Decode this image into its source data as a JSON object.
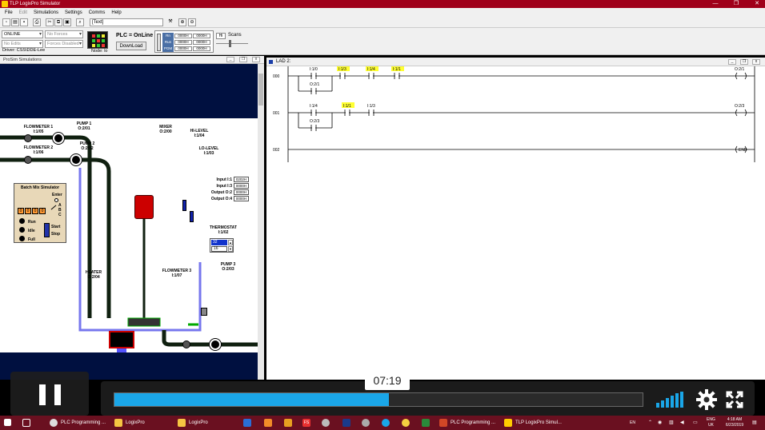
{
  "window": {
    "title": "TLP LogixPro Simulator"
  },
  "menu": [
    "File",
    "Edit",
    "Simulations",
    "Settings",
    "Comms",
    "Help"
  ],
  "toolbar": {
    "text_select": "[Text]"
  },
  "plc_panel": {
    "mode": "ONLINE",
    "forces": "No Forces",
    "edits": "No Edits",
    "forces_state": "Forces Disabled",
    "driver": "Driver: CSS\\DDE-Lee",
    "node": "Node: lo",
    "status": "PLC = OnLine",
    "download": "DownLoad",
    "rpm_labels": [
      "Rn",
      "Run",
      "PGM"
    ],
    "rpm_values": [
      [
        "0000H",
        "0000H"
      ],
      [
        "0000H",
        "0000H"
      ],
      [
        "0000H",
        "0000H"
      ]
    ],
    "scan_value": "Hi",
    "scan_label": "Scans"
  },
  "sim": {
    "title": "ProSim Simulations",
    "flowmeter1": "FLOWMETER 1\nI:1/05",
    "flowmeter2": "FLOWMETER 2\nI:1/06",
    "pump1": "PUMP 1\nO:2/01",
    "pump2": "PUMP 2\nO:2/02",
    "mixer": "MIXER\nO:2/00",
    "hilevel": "HI-LEVEL\nI:1/04",
    "lolevel": "LO-LEVEL\nI:1/03",
    "input1": "Input I:1",
    "input1_val": "0202H",
    "input3": "Input I:3",
    "input3_val": "0000H",
    "output2": "Output O:2",
    "output2_val": "0000H",
    "output4": "Output O:4",
    "output4_val": "0000H",
    "thermostat": "THERMOSTAT\nI:1/02",
    "thermo_set": "32",
    "thermo_act": "16",
    "pump3": "PUMP 3\nO:2/03",
    "flowmeter3": "FLOWMETER 3\nI:1/07",
    "heater": "HEATER\nO:2/04",
    "batch_title": "Batch Mix Simulator",
    "enter": "Enter",
    "abc": [
      "A",
      "B",
      "C"
    ],
    "digits": [
      "0",
      "0",
      "0",
      "0"
    ],
    "run": "Run",
    "idle": "Idle",
    "full": "Full",
    "start": "Start",
    "stop": "Stop"
  },
  "lad": {
    "title": "LAD 2:",
    "rungs": [
      {
        "num": "000",
        "contacts": [
          "I:1/0",
          "I:1/3",
          "I:1/4",
          "I:1/1"
        ],
        "highlight": [
          false,
          true,
          true,
          true
        ],
        "branch": "O:2/1",
        "coil": "O:2/1"
      },
      {
        "num": "001",
        "contacts": [
          "I:1/4",
          "I:1/1",
          "I:1/3"
        ],
        "highlight": [
          false,
          true,
          false
        ],
        "branch": "O:2/3",
        "coil": "O:2/3"
      },
      {
        "num": "002",
        "end": "END"
      }
    ]
  },
  "video": {
    "time": "07:19",
    "progress": 0.52
  },
  "taskbar": {
    "items": [
      "PLC Programming ...",
      "LogixPro",
      "LogixPro",
      "PLC Programming ...",
      "TLP LogixPro Simul..."
    ],
    "lang": "ENG\nUK",
    "time": "4:18 AM",
    "date": "6/23/2019"
  },
  "colors": {
    "title_bg": "#a0001a",
    "highlight": "#ffff33",
    "progress": "#1aa6e8",
    "taskbar": "#6a1020"
  }
}
